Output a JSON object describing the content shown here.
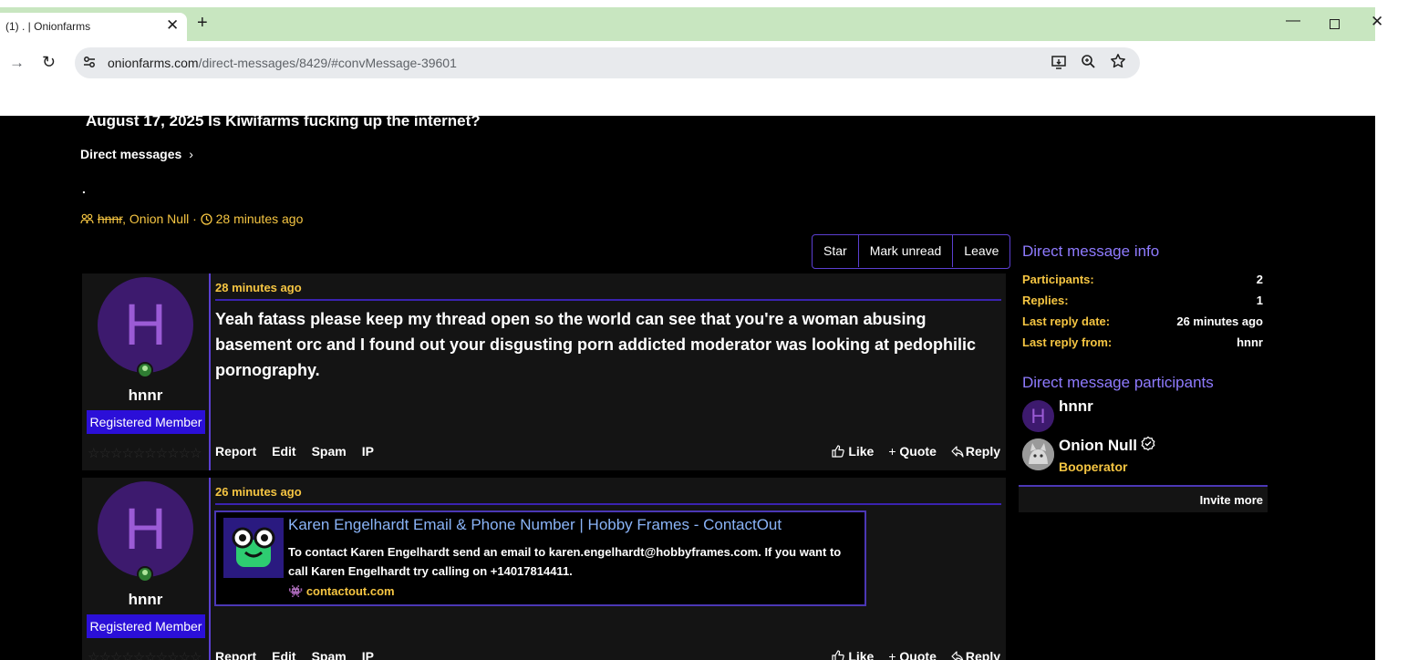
{
  "browser": {
    "tab_title": "(1) . | Onionfarms",
    "tab_close": "✕",
    "new_tab": "+",
    "url_host": "onionfarms.com",
    "url_path": "/direct-messages/8429/#convMessage-39601",
    "window": {
      "minimize": "—",
      "close": "✕"
    }
  },
  "page": {
    "title": "August 17, 2025 Is Kiwifarms fucking up the internet?",
    "breadcrumb": "Direct messages",
    "breadcrumb_chevron": "›",
    "conversation_title": ".",
    "meta": {
      "participants_icon": "users-icon",
      "user1": "hnnr",
      "rest": ", Onion Null · ",
      "clock_icon": "clock-icon",
      "time": "28 minutes ago"
    },
    "actions": {
      "star": "Star",
      "mark_unread": "Mark unread",
      "leave": "Leave"
    }
  },
  "messages": [
    {
      "avatar_letter": "H",
      "username": "hnnr",
      "role": "Registered Member",
      "stars": "☆☆☆☆☆☆☆☆☆☆",
      "time": "28 minutes ago",
      "body": "Yeah fatass please keep my thread open so the world can see that you're a woman abusing basement orc and I found out your disgusting porn addicted moderator was looking at pedophilic pornography.",
      "footer_left": [
        "Report",
        "Edit",
        "Spam",
        "IP"
      ],
      "like": "Like",
      "quote": "Quote",
      "reply": "Reply"
    },
    {
      "avatar_letter": "H",
      "username": "hnnr",
      "role": "Registered Member",
      "stars": "☆☆☆☆☆☆☆☆☆☆",
      "time": "26 minutes ago",
      "unfurl": {
        "title": "Karen Engelhardt Email & Phone Number | Hobby Frames - ContactOut",
        "description": "To contact Karen Engelhardt send an email to karen.engelhardt@hobbyframes.com. If you want to call Karen Engelhardt try calling on +14017814411.",
        "source": "contactout.com"
      },
      "footer_left": [
        "Report",
        "Edit",
        "Spam",
        "IP"
      ],
      "like": "Like",
      "quote": "Quote",
      "reply": "Reply"
    }
  ],
  "sidebar": {
    "info_heading": "Direct message info",
    "info": [
      {
        "label": "Participants:",
        "value": "2"
      },
      {
        "label": "Replies:",
        "value": "1"
      },
      {
        "label": "Last reply date:",
        "value": "26 minutes ago"
      },
      {
        "label": "Last reply from:",
        "value": "hnnr"
      }
    ],
    "participants_heading": "Direct message participants",
    "participants": [
      {
        "letter": "H",
        "name": "hnnr",
        "role": ""
      },
      {
        "letter": "",
        "name": "Onion Null",
        "role": "Booperator"
      }
    ],
    "invite": "Invite more"
  },
  "colors": {
    "accent": "#5b3fd1",
    "gold": "#f5c542",
    "role_badge": "#2b0fd8",
    "tab_strip": "#c8e6c0"
  }
}
